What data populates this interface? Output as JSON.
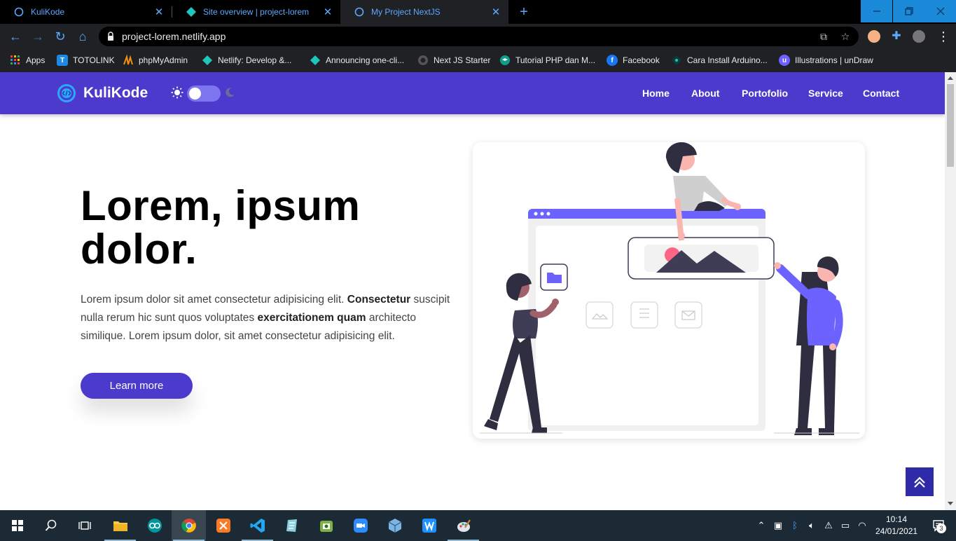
{
  "browser": {
    "tabs": [
      {
        "title": "KuliKode"
      },
      {
        "title": "Site overview | project-lorem"
      },
      {
        "title": "My Project NextJS"
      }
    ],
    "new_tab": "+",
    "url": "project-lorem.netlify.app",
    "bookmarks": [
      {
        "label": "Apps"
      },
      {
        "label": "TOTOLINK"
      },
      {
        "label": "phpMyAdmin"
      },
      {
        "label": "Netlify: Develop &..."
      },
      {
        "label": "Announcing one-cli..."
      },
      {
        "label": "Next JS Starter"
      },
      {
        "label": "Tutorial PHP dan M..."
      },
      {
        "label": "Facebook"
      },
      {
        "label": "Cara Install Arduino..."
      },
      {
        "label": "Illustrations | unDraw"
      }
    ]
  },
  "site": {
    "brand": "KuliKode",
    "nav": [
      "Home",
      "About",
      "Portofolio",
      "Service",
      "Contact"
    ],
    "hero": {
      "title_line1": "Lorem, ipsum",
      "title_line2": "dolor.",
      "text_1": "Lorem ipsum dolor sit amet consectetur adipisicing elit. ",
      "bold_1": "Consectetur",
      "text_2": " suscipit nulla rerum hic sunt quos voluptates ",
      "bold_2": "exercitationem quam",
      "text_3": " architecto similique. Lorem ipsum dolor, sit amet consectetur adipisicing elit.",
      "cta": "Learn more"
    },
    "theme_toggle": {
      "dark_mode": false
    }
  },
  "taskbar": {
    "time": "10:14",
    "date": "24/01/2021",
    "notifications": "3"
  },
  "colors": {
    "brand": "#4b3acb",
    "accent_illustration": "#6c63ff",
    "chrome_link": "#5aa9ff"
  }
}
